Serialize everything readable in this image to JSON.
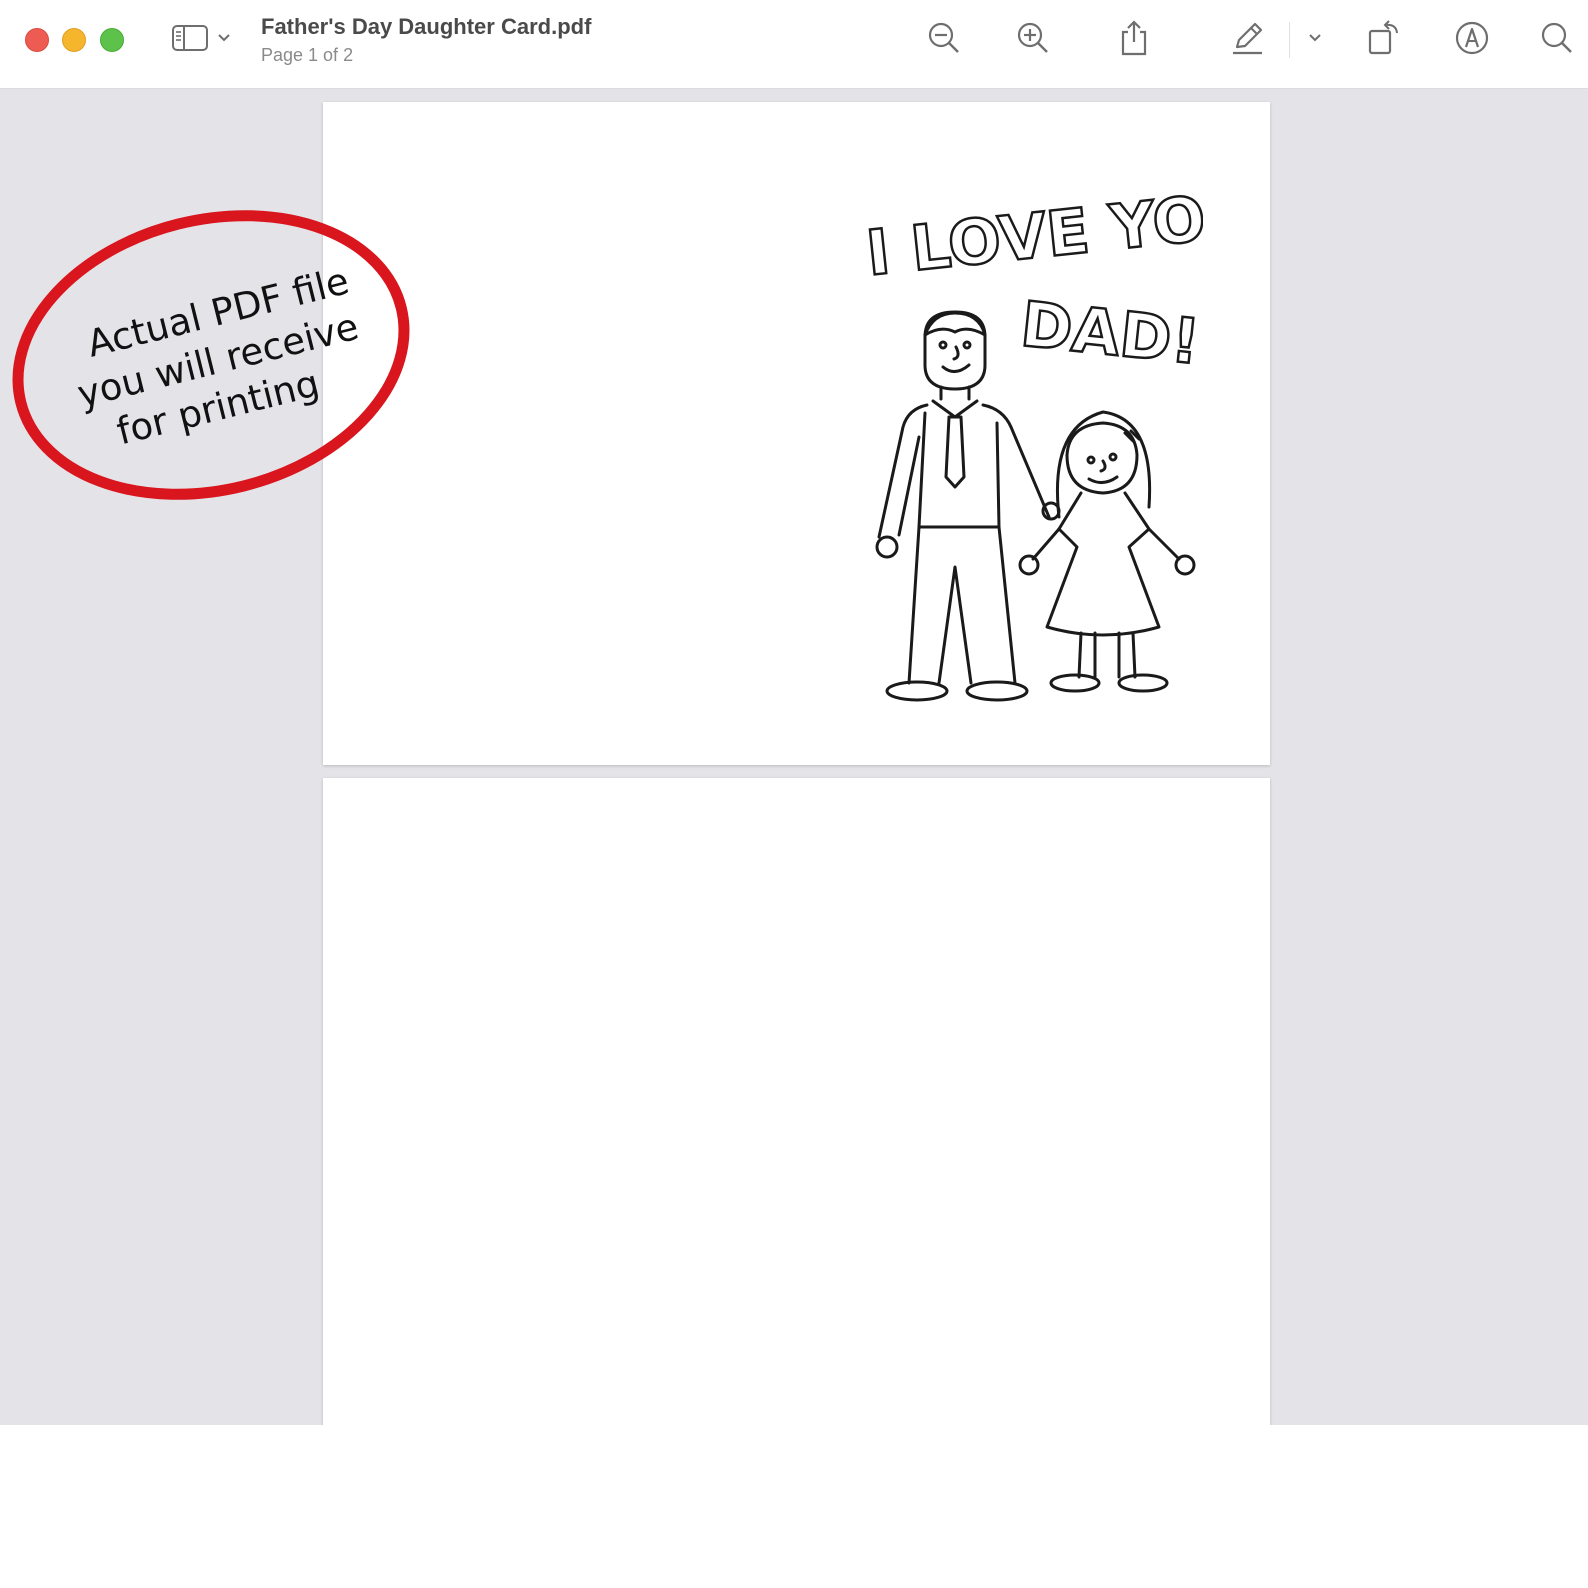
{
  "window": {
    "title": "Father's Day Daughter Card.pdf",
    "subtitle": "Page 1 of 2"
  },
  "toolbar": {
    "icons": [
      "sidebar-icon",
      "chevron-down-icon",
      "zoom-out-icon",
      "zoom-in-icon",
      "share-icon",
      "markup-pen-icon",
      "chevron-down-icon",
      "rotate-icon",
      "annotate-icon",
      "search-icon"
    ]
  },
  "card": {
    "line1": "I LOVE YOU,",
    "line2": "DAD!"
  },
  "annotation": {
    "line1": "Actual PDF file",
    "line2": "you will receive",
    "line3": "for  printing",
    "color": "#d9151e"
  },
  "colors": {
    "close": "#ee5b53",
    "minimize": "#f5b52d",
    "maximize": "#5dc24a",
    "background": "#e4e4e8"
  }
}
